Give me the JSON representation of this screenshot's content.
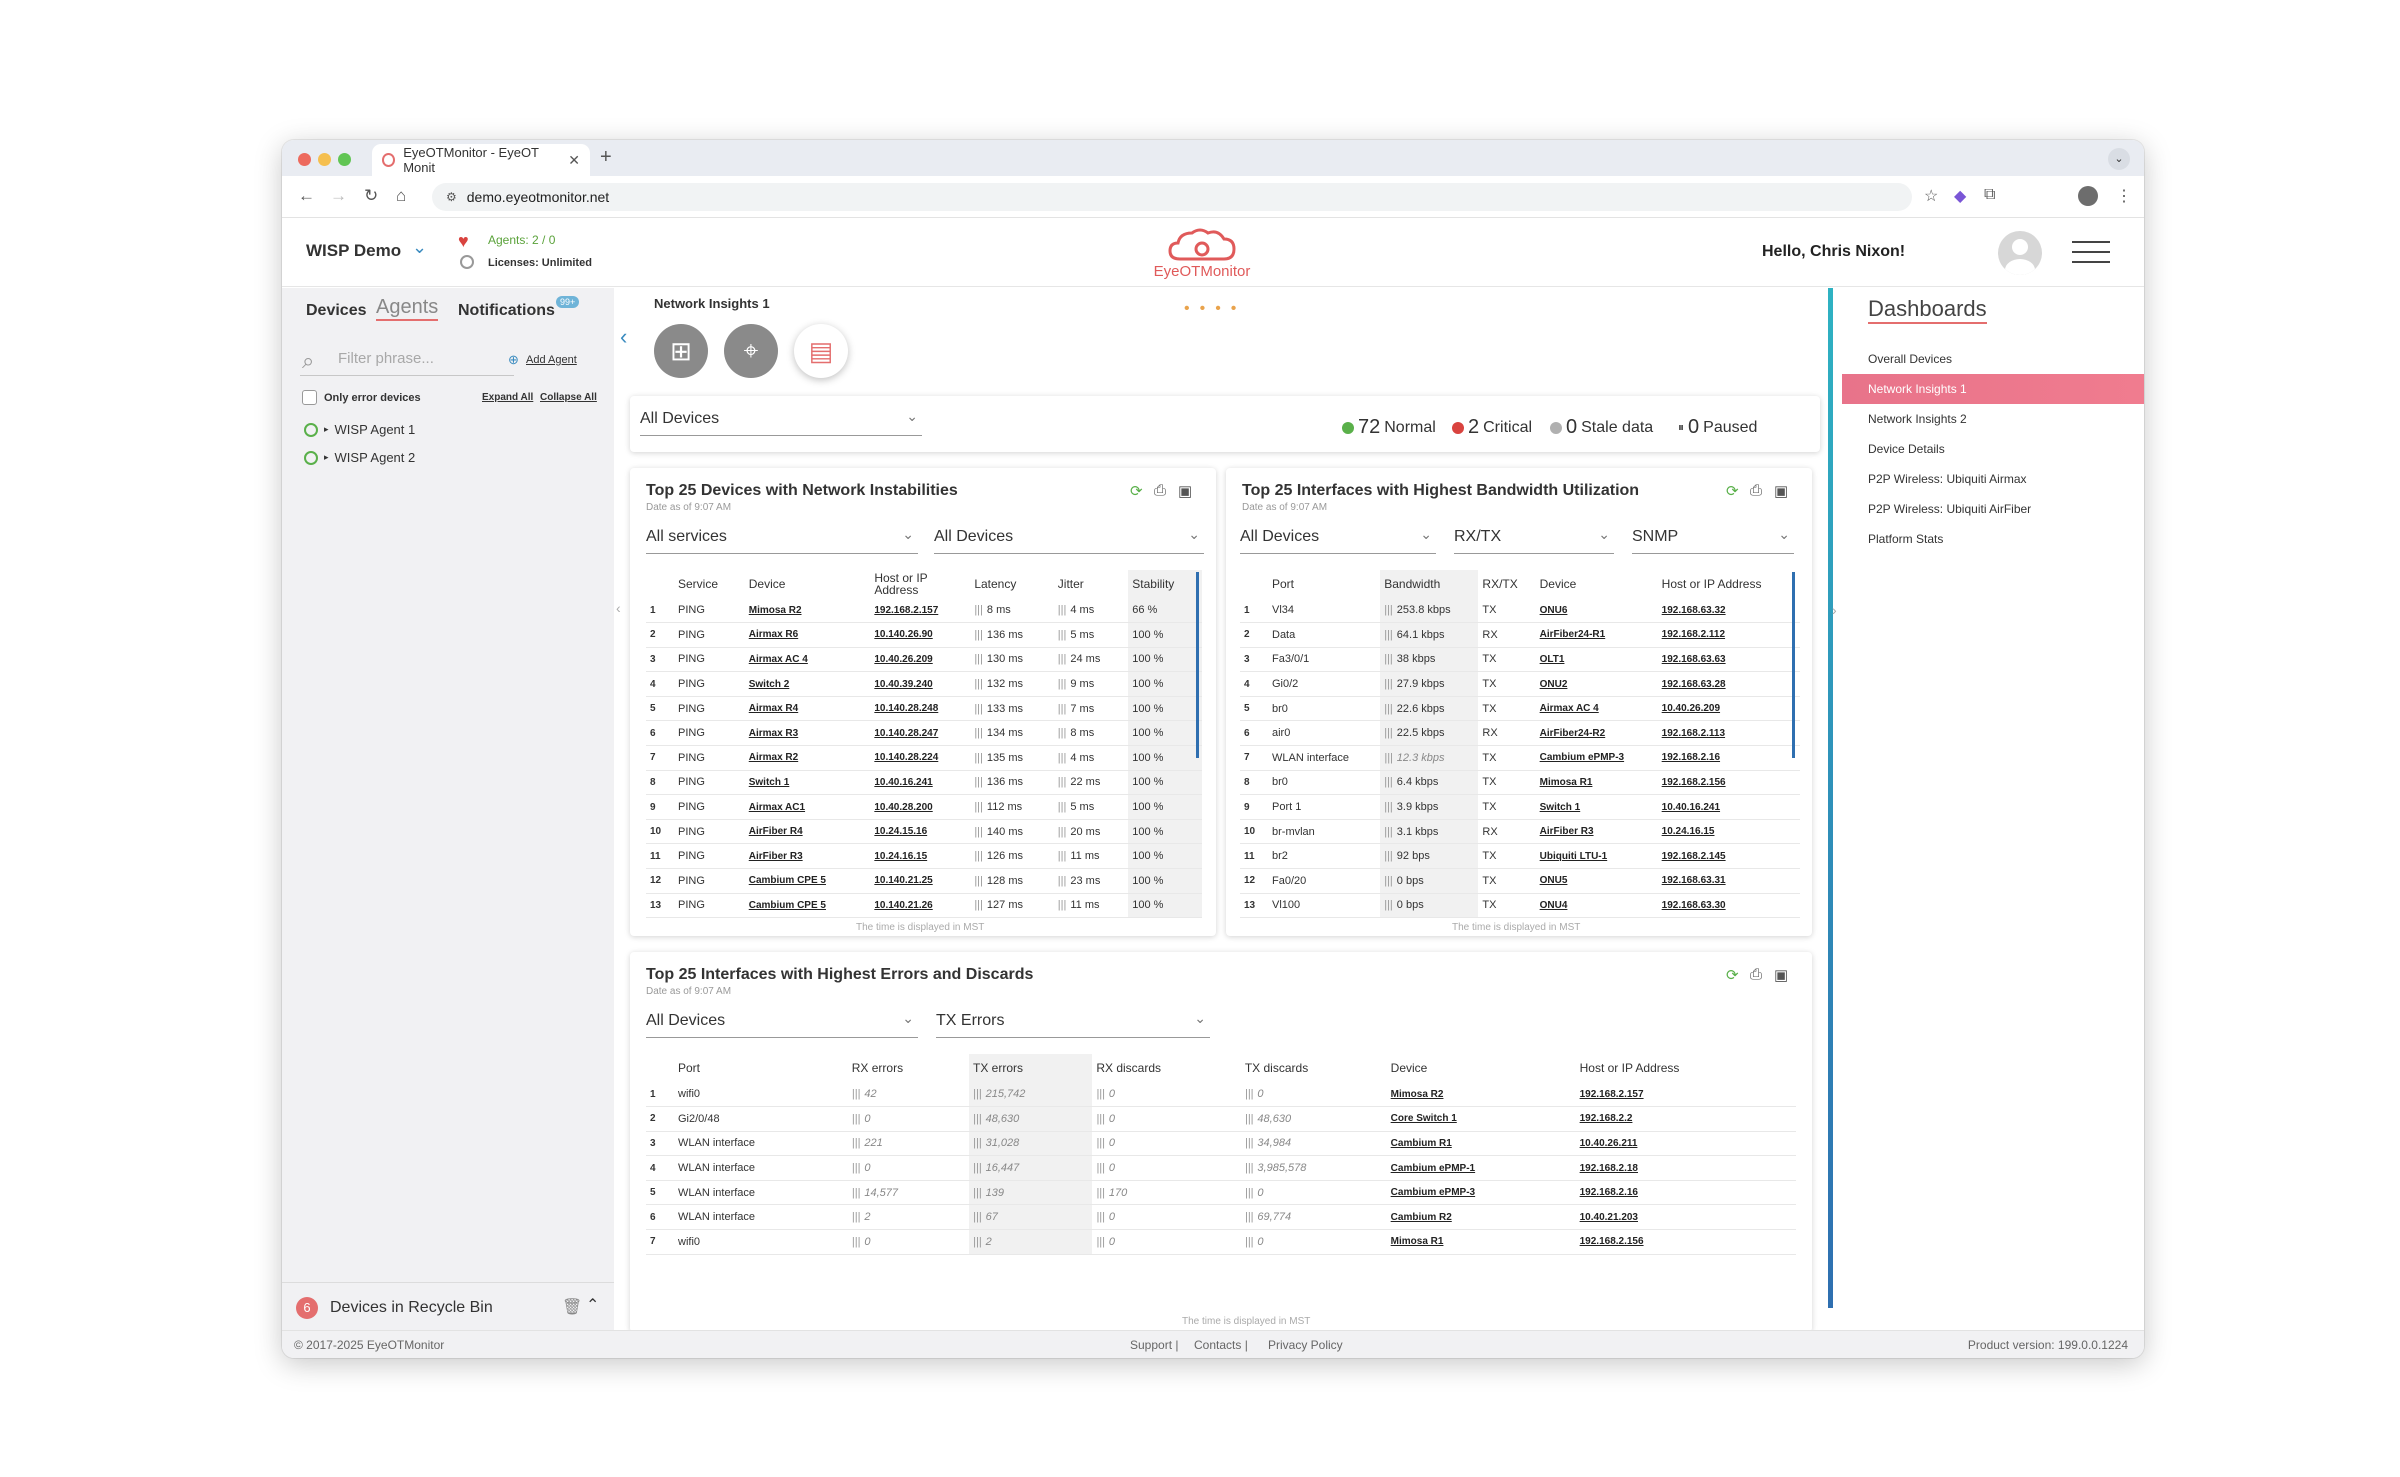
{
  "browser": {
    "tab_title": "EyeOTMonitor - EyeOT Monit",
    "url": "demo.eyeotmonitor.net"
  },
  "header": {
    "org_name": "WISP Demo",
    "agents_status": "Agents: 2 / 0",
    "licenses": "Licenses: Unlimited",
    "logo_text": "EyeOTMonitor",
    "greeting": "Hello, Chris Nixon!"
  },
  "left": {
    "tabs": [
      "Devices",
      "Agents",
      "Notifications"
    ],
    "notif_badge": "99+",
    "filter_placeholder": "Filter phrase...",
    "add_agent": "Add Agent",
    "only_errors": "Only error devices",
    "expand_all": "Expand All",
    "collapse_all": "Collapse All",
    "agents": [
      "WISP Agent 1",
      "WISP Agent 2"
    ],
    "recycle_count": "6",
    "recycle_label": "Devices in Recycle Bin"
  },
  "main": {
    "dashboard_name": "Network Insights 1",
    "device_filter": "All Devices",
    "stats": {
      "normal_count": "72",
      "normal_label": "Normal",
      "critical_count": "2",
      "critical_label": "Critical",
      "stale_count": "0",
      "stale_label": "Stale data",
      "paused_count": "0",
      "paused_label": "Paused"
    },
    "colors": {
      "normal": "#5ab04a",
      "critical": "#d9433f",
      "stale": "#b0b0b0",
      "paused": "#555555"
    }
  },
  "instab": {
    "title": "Top 25 Devices with Network Instabilities",
    "subtitle": "Date as of 9:07 AM",
    "filter1": "All services",
    "filter2": "All Devices",
    "headers": [
      "Service",
      "Device",
      "Host or IP Address",
      "Latency",
      "Jitter",
      "Stability"
    ],
    "rows": [
      [
        "1",
        "PING",
        "Mimosa R2",
        "192.168.2.157",
        "8 ms",
        "4 ms",
        "66 %"
      ],
      [
        "2",
        "PING",
        "Airmax R6",
        "10.140.26.90",
        "136 ms",
        "5 ms",
        "100 %"
      ],
      [
        "3",
        "PING",
        "Airmax AC 4",
        "10.40.26.209",
        "130 ms",
        "24 ms",
        "100 %"
      ],
      [
        "4",
        "PING",
        "Switch 2",
        "10.40.39.240",
        "132 ms",
        "9 ms",
        "100 %"
      ],
      [
        "5",
        "PING",
        "Airmax R4",
        "10.140.28.248",
        "133 ms",
        "7 ms",
        "100 %"
      ],
      [
        "6",
        "PING",
        "Airmax R3",
        "10.140.28.247",
        "134 ms",
        "8 ms",
        "100 %"
      ],
      [
        "7",
        "PING",
        "Airmax R2",
        "10.140.28.224",
        "135 ms",
        "4 ms",
        "100 %"
      ],
      [
        "8",
        "PING",
        "Switch 1",
        "10.40.16.241",
        "136 ms",
        "22 ms",
        "100 %"
      ],
      [
        "9",
        "PING",
        "Airmax AC1",
        "10.40.28.200",
        "112 ms",
        "5 ms",
        "100 %"
      ],
      [
        "10",
        "PING",
        "AirFiber R4",
        "10.24.15.16",
        "140 ms",
        "20 ms",
        "100 %"
      ],
      [
        "11",
        "PING",
        "AirFiber R3",
        "10.24.16.15",
        "126 ms",
        "11 ms",
        "100 %"
      ],
      [
        "12",
        "PING",
        "Cambium CPE 5",
        "10.140.21.25",
        "128 ms",
        "23 ms",
        "100 %"
      ],
      [
        "13",
        "PING",
        "Cambium CPE 5",
        "10.140.21.26",
        "127 ms",
        "11 ms",
        "100 %"
      ]
    ],
    "footnote": "The time is displayed in MST"
  },
  "bw": {
    "title": "Top 25 Interfaces with Highest Bandwidth Utilization",
    "subtitle": "Date as of 9:07 AM",
    "filter1": "All Devices",
    "filter2": "RX/TX",
    "filter3": "SNMP",
    "headers": [
      "Port",
      "Bandwidth",
      "RX/TX",
      "Device",
      "Host or IP Address"
    ],
    "rows": [
      [
        "1",
        "Vl34",
        "253.8 kbps",
        "TX",
        "ONU6",
        "192.168.63.32"
      ],
      [
        "2",
        "Data",
        "64.1 kbps",
        "RX",
        "AirFiber24-R1",
        "192.168.2.112"
      ],
      [
        "3",
        "Fa3/0/1",
        "38 kbps",
        "TX",
        "OLT1",
        "192.168.63.63"
      ],
      [
        "4",
        "Gi0/2",
        "27.9 kbps",
        "TX",
        "ONU2",
        "192.168.63.28"
      ],
      [
        "5",
        "br0",
        "22.6 kbps",
        "TX",
        "Airmax AC 4",
        "10.40.26.209"
      ],
      [
        "6",
        "air0",
        "22.5 kbps",
        "RX",
        "AirFiber24-R2",
        "192.168.2.113"
      ],
      [
        "7",
        "WLAN interface",
        "12.3 kbps",
        "TX",
        "Cambium ePMP-3",
        "192.168.2.16"
      ],
      [
        "8",
        "br0",
        "6.4 kbps",
        "TX",
        "Mimosa R1",
        "192.168.2.156"
      ],
      [
        "9",
        "Port 1",
        "3.9 kbps",
        "TX",
        "Switch 1",
        "10.40.16.241"
      ],
      [
        "10",
        "br-mvlan",
        "3.1 kbps",
        "RX",
        "AirFiber R3",
        "10.24.16.15"
      ],
      [
        "11",
        "br2",
        "92 bps",
        "TX",
        "Ubiquiti LTU-1",
        "192.168.2.145"
      ],
      [
        "12",
        "Fa0/20",
        "0 bps",
        "TX",
        "ONU5",
        "192.168.63.31"
      ],
      [
        "13",
        "Vl100",
        "0 bps",
        "TX",
        "ONU4",
        "192.168.63.30"
      ]
    ],
    "footnote": "The time is displayed in MST"
  },
  "errs": {
    "title": "Top 25 Interfaces with Highest Errors and Discards",
    "subtitle": "Date as of 9:07 AM",
    "filter1": "All Devices",
    "filter2": "TX Errors",
    "headers": [
      "Port",
      "RX errors",
      "TX errors",
      "RX discards",
      "TX discards",
      "Device",
      "Host or IP Address"
    ],
    "rows": [
      [
        "1",
        "wifi0",
        "42",
        "215,742",
        "0",
        "0",
        "Mimosa R2",
        "192.168.2.157"
      ],
      [
        "2",
        "Gi2/0/48",
        "0",
        "48,630",
        "0",
        "48,630",
        "Core Switch 1",
        "192.168.2.2"
      ],
      [
        "3",
        "WLAN interface",
        "221",
        "31,028",
        "0",
        "34,984",
        "Cambium R1",
        "10.40.26.211"
      ],
      [
        "4",
        "WLAN interface",
        "0",
        "16,447",
        "0",
        "3,985,578",
        "Cambium ePMP-1",
        "192.168.2.18"
      ],
      [
        "5",
        "WLAN interface",
        "14,577",
        "139",
        "170",
        "0",
        "Cambium ePMP-3",
        "192.168.2.16"
      ],
      [
        "6",
        "WLAN interface",
        "2",
        "67",
        "0",
        "69,774",
        "Cambium R2",
        "10.40.21.203"
      ],
      [
        "7",
        "wifi0",
        "0",
        "2",
        "0",
        "0",
        "Mimosa R1",
        "192.168.2.156"
      ]
    ],
    "footnote": "The time is displayed in MST"
  },
  "dashboards": {
    "title": "Dashboards",
    "items": [
      "Overall Devices",
      "Network Insights 1",
      "Network Insights 2",
      "Device Details",
      "P2P Wireless: Ubiquiti Airmax",
      "P2P Wireless: Ubiquiti AirFiber",
      "Platform Stats"
    ]
  },
  "footer": {
    "copyright": "© 2017-2025 EyeOTMonitor",
    "support": "Support |",
    "contacts": "Contacts |",
    "privacy": "Privacy Policy",
    "version": "Product version: 199.0.0.1224"
  }
}
